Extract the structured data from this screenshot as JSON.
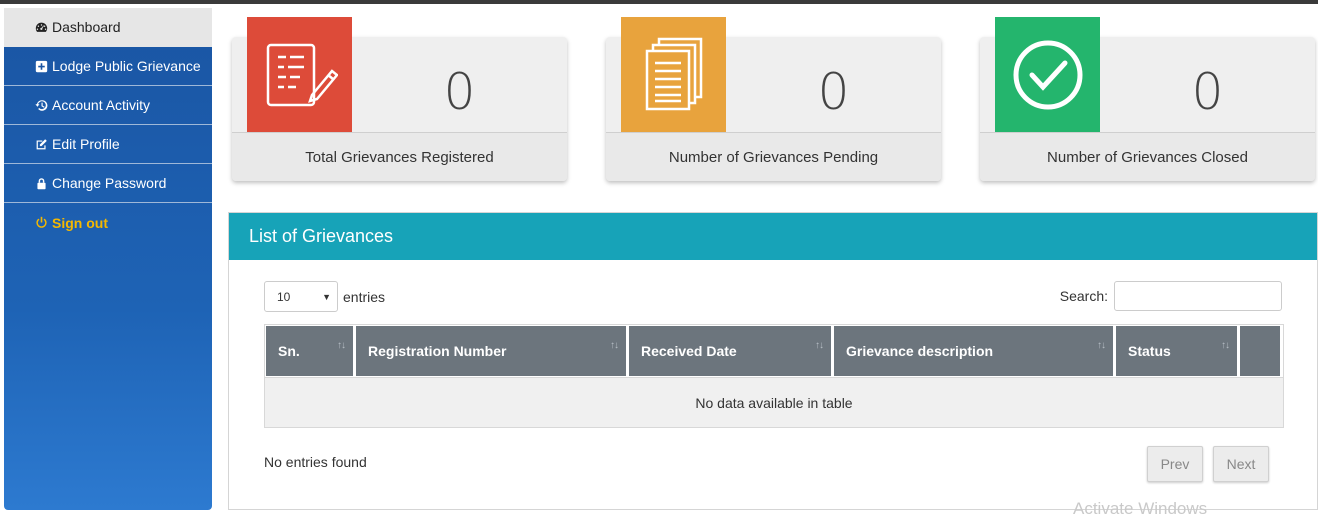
{
  "sidebar": {
    "items": [
      {
        "label": "Dashboard",
        "icon": "dashboard-icon"
      },
      {
        "label": "Lodge Public Grievance",
        "icon": "plus-square-icon"
      },
      {
        "label": "Account Activity",
        "icon": "history-icon"
      },
      {
        "label": "Edit Profile",
        "icon": "edit-icon"
      },
      {
        "label": "Change Password",
        "icon": "lock-icon"
      },
      {
        "label": "Sign out",
        "icon": "power-icon"
      }
    ]
  },
  "stats": [
    {
      "value": "0",
      "label": "Total Grievances Registered",
      "color": "#dd4b39",
      "icon": "form-edit-icon"
    },
    {
      "value": "0",
      "label": "Number of Grievances Pending",
      "color": "#e8a33d",
      "icon": "documents-icon"
    },
    {
      "value": "0",
      "label": "Number of Grievances Closed",
      "color": "#24b56d",
      "icon": "check-circle-icon"
    }
  ],
  "panel": {
    "title": "List of Grievances",
    "page_length": "10",
    "entries_label": "entries",
    "search_label": "Search:",
    "columns": [
      "Sn.",
      "Registration Number",
      "Received Date",
      "Grievance description",
      "Status",
      ""
    ],
    "empty_message": "No data available in table",
    "info": "No entries found",
    "prev_label": "Prev",
    "next_label": "Next"
  },
  "watermark": "Activate Windows",
  "colors": {
    "sidebar": "#1a55a3",
    "signout": "#f5b800",
    "panel_header": "#17a3b8",
    "table_header": "#6c757d"
  }
}
